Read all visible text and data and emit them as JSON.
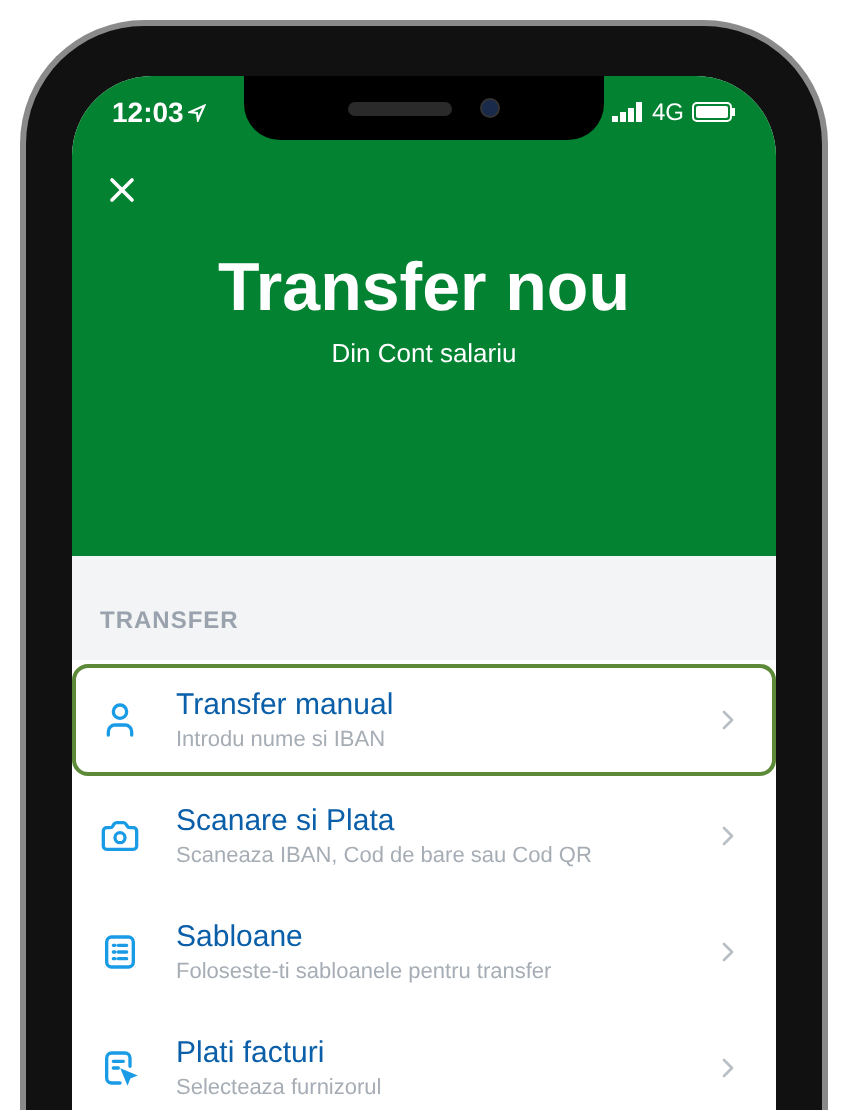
{
  "status_bar": {
    "time": "12:03",
    "network": "4G"
  },
  "header": {
    "title": "Transfer nou",
    "subtitle": "Din Cont salariu"
  },
  "section": {
    "title": "TRANSFER"
  },
  "items": [
    {
      "title": "Transfer manual",
      "subtitle": "Introdu nume si IBAN",
      "selected": true
    },
    {
      "title": "Scanare si Plata",
      "subtitle": "Scaneaza IBAN, Cod de bare sau Cod QR",
      "selected": false
    },
    {
      "title": "Sabloane",
      "subtitle": "Foloseste-ti sabloanele pentru transfer",
      "selected": false
    },
    {
      "title": "Plati facturi",
      "subtitle": "Selecteaza furnizorul",
      "selected": false
    }
  ]
}
